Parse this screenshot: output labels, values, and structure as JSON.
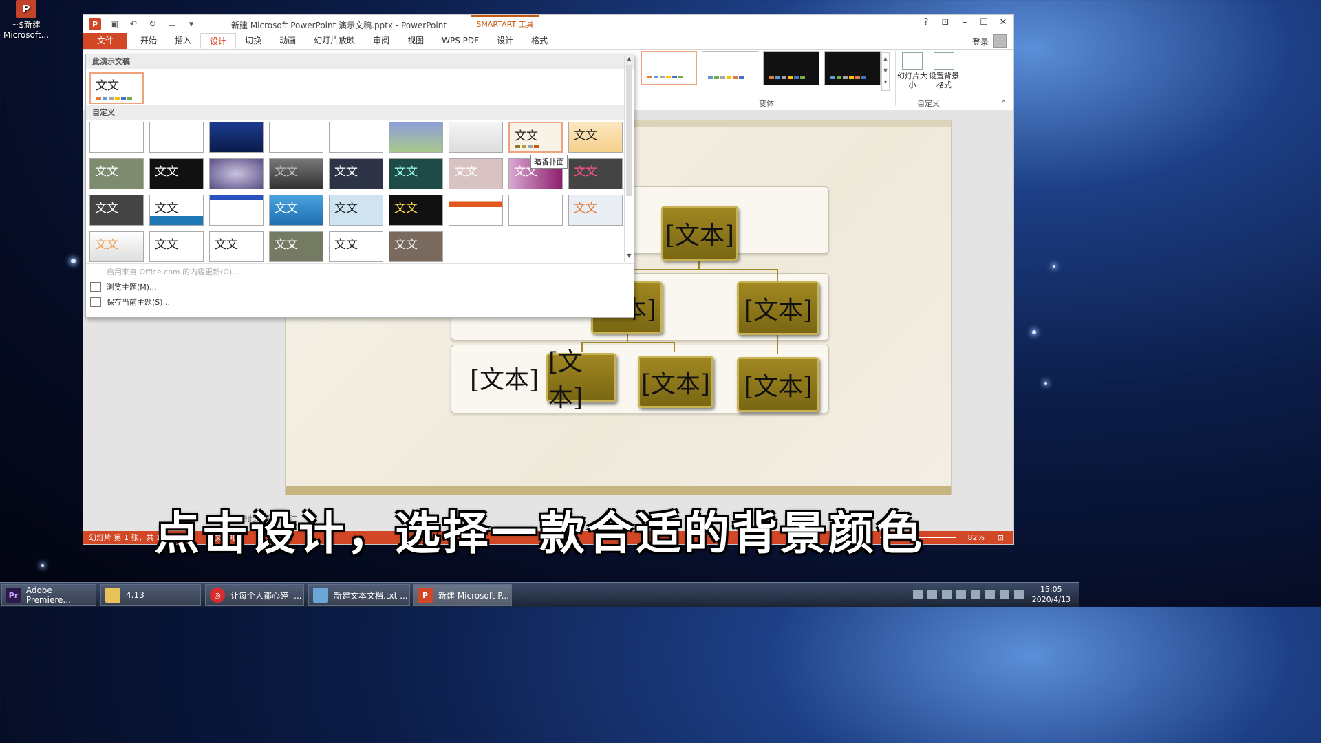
{
  "desktop": {
    "icon_label": "~$新建 Microsoft..."
  },
  "window": {
    "title": "新建 Microsoft PowerPoint 演示文稿.pptx - PowerPoint",
    "smartart_tools": "SMARTART 工具",
    "help": "?",
    "login": "登录"
  },
  "tabs": [
    "文件",
    "开始",
    "插入",
    "设计",
    "切换",
    "动画",
    "幻灯片放映",
    "审阅",
    "视图",
    "WPS PDF"
  ],
  "smartart_tabs": [
    "设计",
    "格式"
  ],
  "ribbon": {
    "variants_label": "变体",
    "customize_label": "自定义",
    "slide_size": "幻灯片大小",
    "bg_format": "设置背景格式"
  },
  "gallery": {
    "this_presentation": "此演示文稿",
    "custom": "自定义",
    "thumb_text": "文文",
    "tooltip": "暗香扑面",
    "enable_updates": "启用来自 Office.com 的内容更新(O)...",
    "browse": "浏览主题(M)...",
    "save": "保存当前主题(S)..."
  },
  "smartart": {
    "top": "[文本]",
    "mid_left": "本]",
    "mid_right": "[文本]",
    "bottom_plain": "[文本]",
    "bottom_1": "[文本]",
    "bottom_2": "[文本]",
    "bottom_3": "[文本]"
  },
  "notes_placeholder": "单击此处添加备注",
  "status": {
    "slide_info": "幻灯片 第 1 张，共 1",
    "lang": "中文(中国)",
    "zoom": "82%"
  },
  "subtitle": "点击设计，选择一款合适的背景颜色",
  "taskbar": {
    "items": [
      "Adobe Premiere...",
      "4.13",
      "让每个人都心碎 -...",
      "新建文本文档.txt ...",
      "新建 Microsoft P..."
    ],
    "time": "15:05",
    "date": "2020/4/13"
  },
  "colors": {
    "accent": "#d24726",
    "gold": "#8c7619"
  }
}
